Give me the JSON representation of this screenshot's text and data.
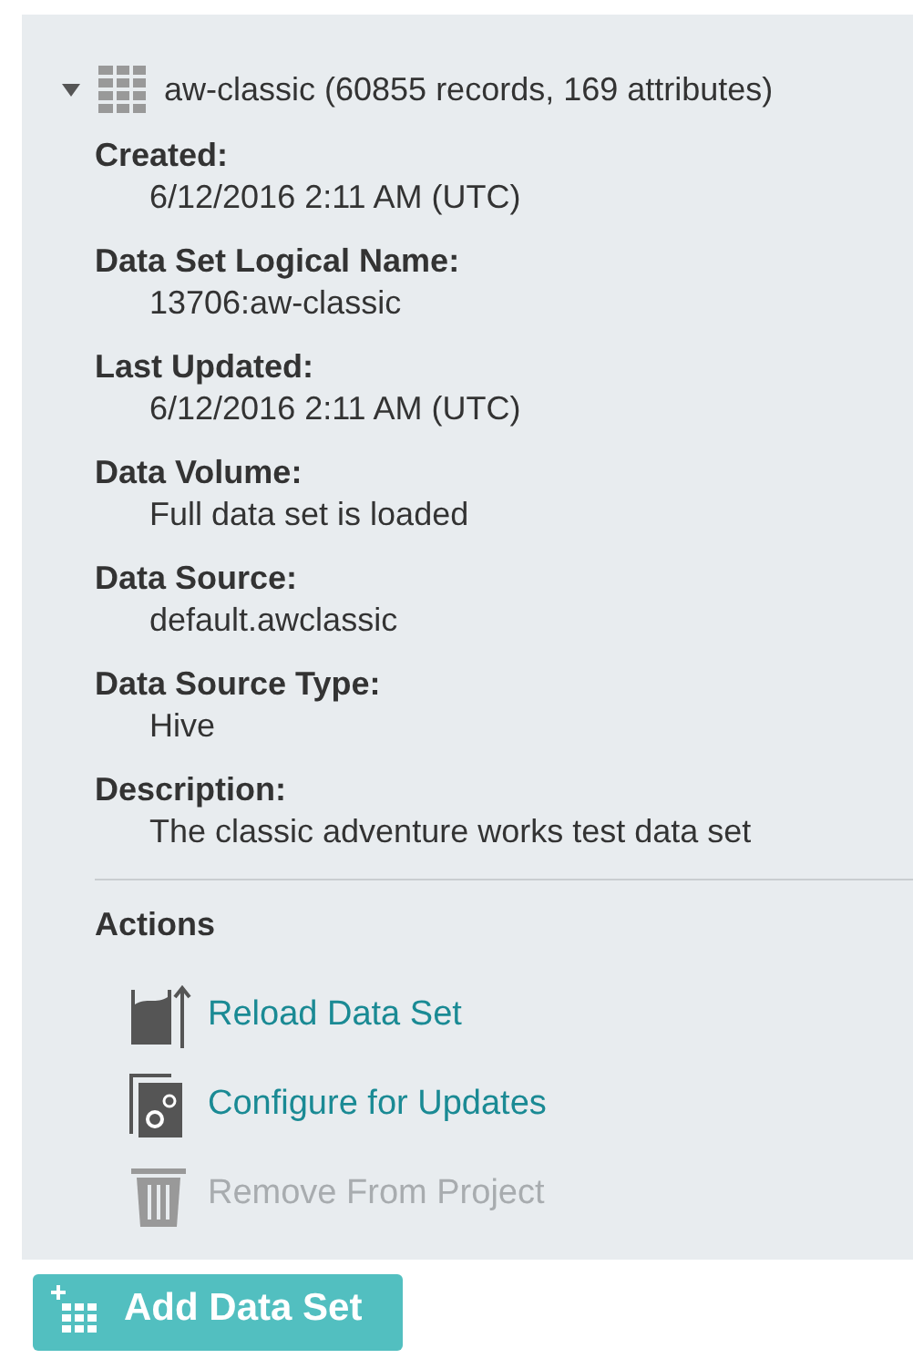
{
  "dataset": {
    "expanded": true,
    "title": "aw-classic (60855 records, 169 attributes)",
    "fields": [
      {
        "label": "Created:",
        "value": "6/12/2016 2:11 AM (UTC)"
      },
      {
        "label": "Data Set Logical Name:",
        "value": "13706:aw-classic"
      },
      {
        "label": "Last Updated:",
        "value": "6/12/2016 2:11 AM (UTC)"
      },
      {
        "label": "Data Volume:",
        "value": "Full data set is loaded"
      },
      {
        "label": "Data Source:",
        "value": "default.awclassic"
      },
      {
        "label": "Data Source Type:",
        "value": "Hive"
      },
      {
        "label": "Description:",
        "value": "The classic adventure works test data set"
      }
    ],
    "actions_title": "Actions",
    "actions": [
      {
        "kind": "reload",
        "label": "Reload Data Set",
        "disabled": false
      },
      {
        "kind": "configure",
        "label": "Configure for Updates",
        "disabled": false
      },
      {
        "kind": "remove",
        "label": "Remove From Project",
        "disabled": true
      }
    ]
  },
  "add_button": "Add Data Set"
}
